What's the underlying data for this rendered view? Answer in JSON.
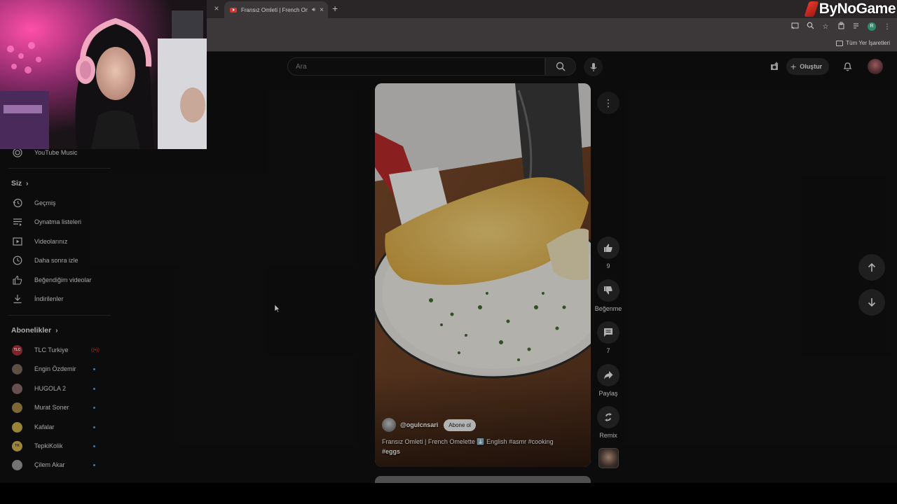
{
  "browser": {
    "tab_title": "Fransız Omleti | French Om",
    "tab_audio_icon": "speaker-icon",
    "new_tab": "+",
    "close_left": "×",
    "close_tab": "×",
    "bookmarks_all": "Tüm Yer İşaretleri"
  },
  "brand": {
    "text": "ByNoGame"
  },
  "header": {
    "search_placeholder": "Ara",
    "create_label": "Oluştur",
    "create_plus": "+"
  },
  "sidebar": {
    "youtube_music": "YouTube Music",
    "you_section": "Siz",
    "you_items": [
      {
        "label": "Geçmiş",
        "icon": "history-icon"
      },
      {
        "label": "Oynatma listeleri",
        "icon": "playlists-icon"
      },
      {
        "label": "Videolarınız",
        "icon": "your-videos-icon"
      },
      {
        "label": "Daha sonra izle",
        "icon": "watch-later-icon"
      },
      {
        "label": "Beğendiğim videolar",
        "icon": "liked-icon"
      },
      {
        "label": "İndirilenler",
        "icon": "download-icon"
      }
    ],
    "subs_section": "Abonelikler",
    "subscriptions": [
      {
        "label": "TLC Turkiye",
        "avatar_text": "TLC",
        "color": "#a8323a",
        "live": true
      },
      {
        "label": "Engin Özdemir",
        "avatar_text": "",
        "color": "#7b6a5a",
        "live": false
      },
      {
        "label": "HUGOLA 2",
        "avatar_text": "",
        "color": "#8a6a6a",
        "live": false
      },
      {
        "label": "Murat Soner",
        "avatar_text": "",
        "color": "#a88a4a",
        "live": false
      },
      {
        "label": "Kafalar",
        "avatar_text": "",
        "color": "#c9b24a",
        "live": false
      },
      {
        "label": "TepkiKolik",
        "avatar_text": "TK",
        "color": "#d4b24a",
        "live": false
      },
      {
        "label": "Çilem Akar",
        "avatar_text": "",
        "color": "#9a9a9a",
        "live": false
      }
    ]
  },
  "short": {
    "channel": "@ogulcnsari",
    "subscribe": "Abone ol",
    "caption": "Fransız Omleti | French Omelette ⬇️ English #asmr #cooking",
    "caption_tags": "#eggs",
    "likes": "9",
    "dislike_label": "Beğenme",
    "comments": "7",
    "share_label": "Paylaş",
    "remix_label": "Remix"
  },
  "colors": {
    "accent_blue": "#3ea6ff",
    "live_red": "#d43333",
    "youtube_red": "#e0332e"
  }
}
